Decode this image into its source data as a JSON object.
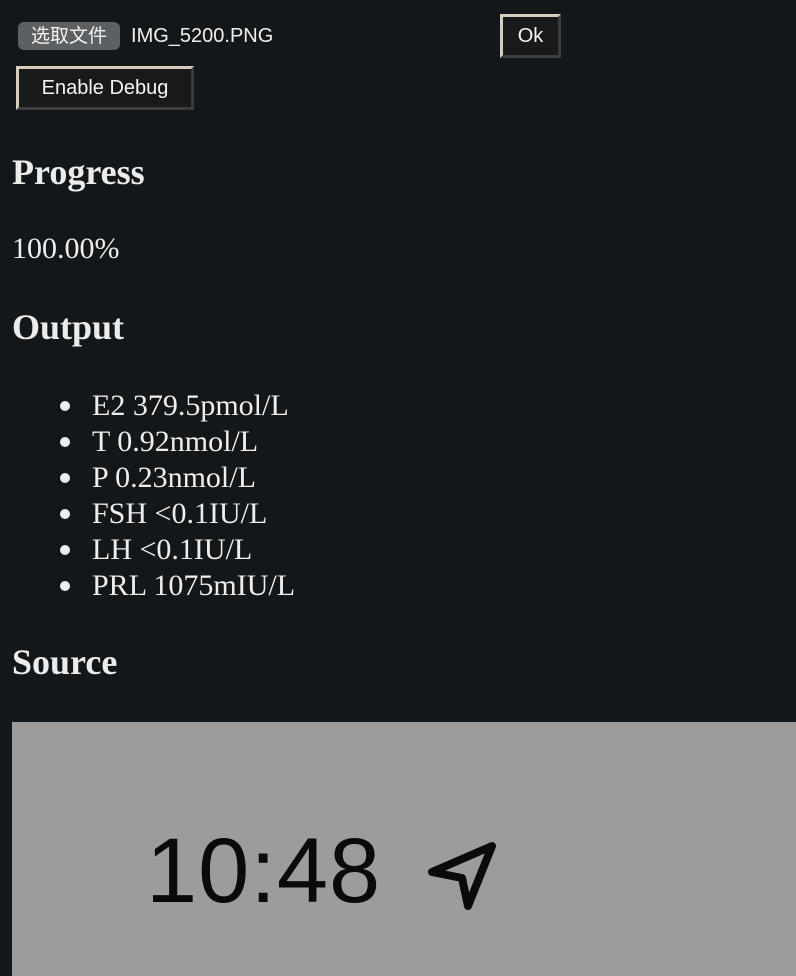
{
  "toolbar": {
    "file_button_label": "选取文件",
    "file_name": "IMG_5200.PNG",
    "ok_label": "Ok",
    "debug_label": "Enable Debug"
  },
  "progress": {
    "heading": "Progress",
    "value": "100.00%"
  },
  "output": {
    "heading": "Output",
    "items": [
      "E2 379.5pmol/L",
      "T 0.92nmol/L",
      "P 0.23nmol/L",
      "FSH <0.1IU/L",
      "LH <0.1IU/L",
      "PRL 1075mIU/L"
    ]
  },
  "source": {
    "heading": "Source",
    "image_time_text": "10:48",
    "image_icon": "location-arrow-icon",
    "image_background": "#9c9c9c"
  },
  "colors": {
    "page_background": "#141719",
    "text": "#eeeeee"
  }
}
